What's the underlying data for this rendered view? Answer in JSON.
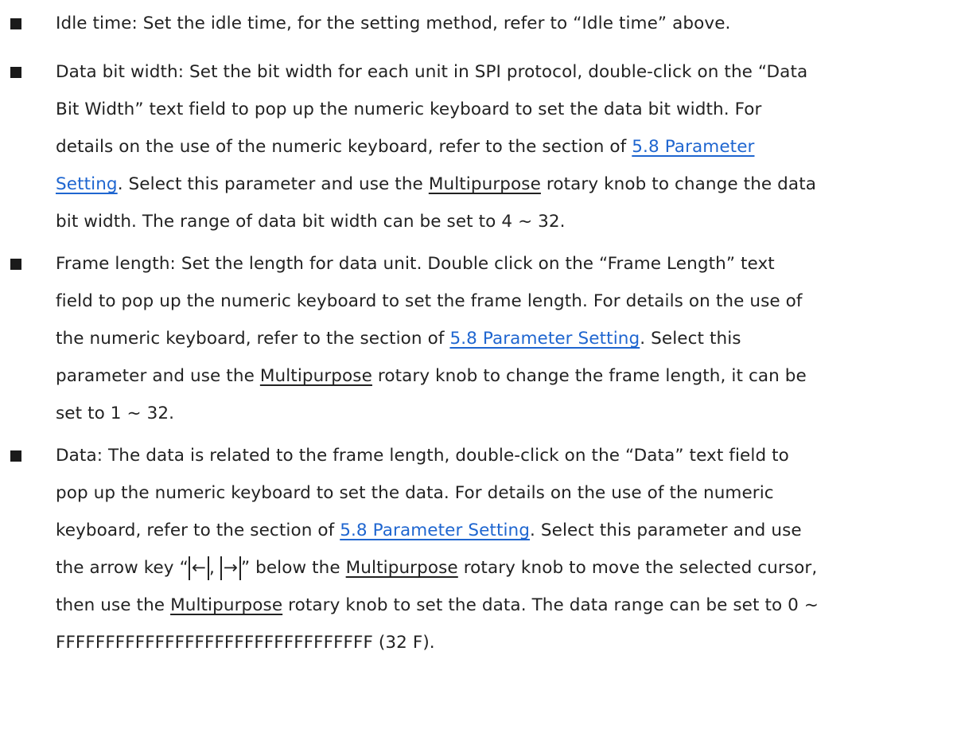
{
  "items": [
    {
      "lines": [
        [
          {
            "t": "Idle time: Set the idle time, for the setting method, refer to “Idle time” above."
          }
        ]
      ]
    },
    {
      "lines": [
        [
          {
            "t": "Data bit width: Set the bit width for each unit in SPI protocol, double-click on the “Data"
          }
        ],
        [
          {
            "t": "Bit Width” text field to pop up the numeric keyboard to set the data bit width. For"
          }
        ],
        [
          {
            "t": "details on the use of the numeric keyboard, refer to the section of "
          },
          {
            "t": "5.8 Parameter ",
            "s": "link"
          }
        ],
        [
          {
            "t": "Setting",
            "s": "link"
          },
          {
            "t": ". Select this parameter and use the "
          },
          {
            "t": "Multipurpose",
            "s": "ul"
          },
          {
            "t": " rotary knob to change the data"
          }
        ],
        [
          {
            "t": "bit width. The range of data bit width can be set to 4 ~ 32."
          }
        ]
      ]
    },
    {
      "lines": [
        [
          {
            "t": "Frame length:  Set the length for data unit. Double click on the “Frame Length” text"
          }
        ],
        [
          {
            "t": "field to pop up the numeric keyboard to set the frame length. For details on the use of"
          }
        ],
        [
          {
            "t": "the numeric keyboard, refer to the section of "
          },
          {
            "t": "5.8 Parameter Setting",
            "s": "link"
          },
          {
            "t": ". Select this"
          }
        ],
        [
          {
            "t": "parameter and use the "
          },
          {
            "t": "Multipurpose",
            "s": "ul"
          },
          {
            "t": " rotary knob to change the frame length, it can be"
          }
        ],
        [
          {
            "t": "set to 1 ~ 32."
          }
        ]
      ]
    },
    {
      "lines": [
        [
          {
            "t": "Data:  The data is related to the frame length, double-click on the “Data” text field to"
          }
        ],
        [
          {
            "t": "pop up the numeric keyboard to set the data. For details on the use of the numeric"
          }
        ],
        [
          {
            "t": "keyboard, refer to the section of "
          },
          {
            "t": "5.8 Parameter Setting",
            "s": "link"
          },
          {
            "t": ". Select this parameter and use"
          }
        ],
        [
          {
            "t": "the arrow key “"
          },
          {
            "t": "←",
            "s": "key"
          },
          {
            "t": ", "
          },
          {
            "t": "→",
            "s": "key"
          },
          {
            "t": "” below the "
          },
          {
            "t": "Multipurpose",
            "s": "ul"
          },
          {
            "t": " rotary knob to move the selected cursor,"
          }
        ],
        [
          {
            "t": "then use the "
          },
          {
            "t": "Multipurpose",
            "s": "ul"
          },
          {
            "t": " rotary knob to set the data. The data range can be set to 0 ~"
          }
        ],
        [
          {
            "t": "FFFFFFFFFFFFFFFFFFFFFFFFFFFFFFFF (32 F)."
          }
        ]
      ]
    }
  ]
}
